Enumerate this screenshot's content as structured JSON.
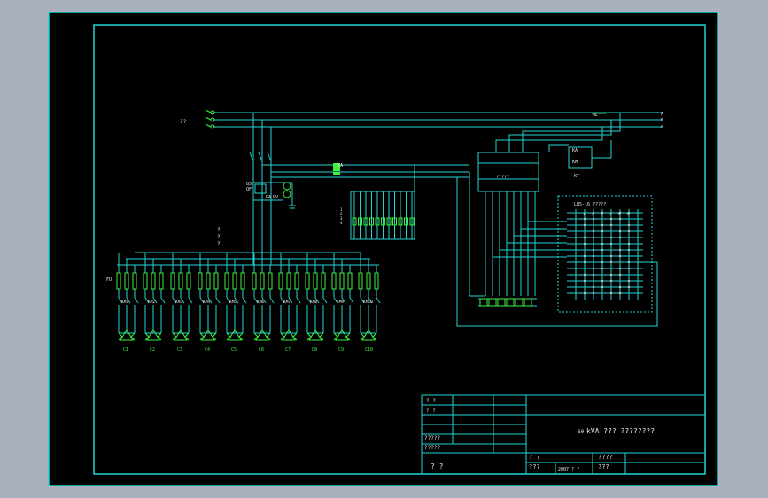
{
  "colors": {
    "background": "#a9b0be",
    "sheet": "#000000",
    "border": "#1fd6d6",
    "wire": "#25d3d3",
    "component": "#3ef23e",
    "text_white": "#e8e8e8"
  },
  "labels": {
    "source": "??",
    "bus_a": "A",
    "bus_b": "B",
    "bus_c": "C",
    "qs": "QS",
    "qf": "QF",
    "ta": "TA",
    "pa": "PA",
    "pv": "PV",
    "meter": "?????",
    "rl": "RL",
    "kt": "KT",
    "ka": "KA",
    "km": "KM",
    "lw": "LW5-16  ?????",
    "cap_mark": "?",
    "fuse_label": "FU",
    "cap_numbers": [
      "C1",
      "C2",
      "C3",
      "C4",
      "C5",
      "C6",
      "C7",
      "C8",
      "C9",
      "C10"
    ],
    "switch_labels": [
      "KM1",
      "KM2",
      "KM3",
      "KM4",
      "KM5",
      "KM6",
      "KM7",
      "KM8",
      "KM9",
      "KM10"
    ],
    "terminal_labels": [
      "1",
      "2",
      "3",
      "4"
    ],
    "lw_columns": [
      "1",
      "2",
      "3",
      "4",
      "5",
      "6"
    ]
  },
  "title_block": {
    "title": "kVA ??? ????????",
    "title_prefix": "60",
    "left_rows": [
      "? ?",
      "? ?",
      "",
      "",
      "?????",
      "?????"
    ],
    "bottom_left": "? ?",
    "bottom_mid_a": "? ?",
    "bottom_mid_b": "???",
    "bottom_mid_c": "2007 ? ?",
    "bottom_right_a": "????",
    "bottom_right_b": "???"
  }
}
